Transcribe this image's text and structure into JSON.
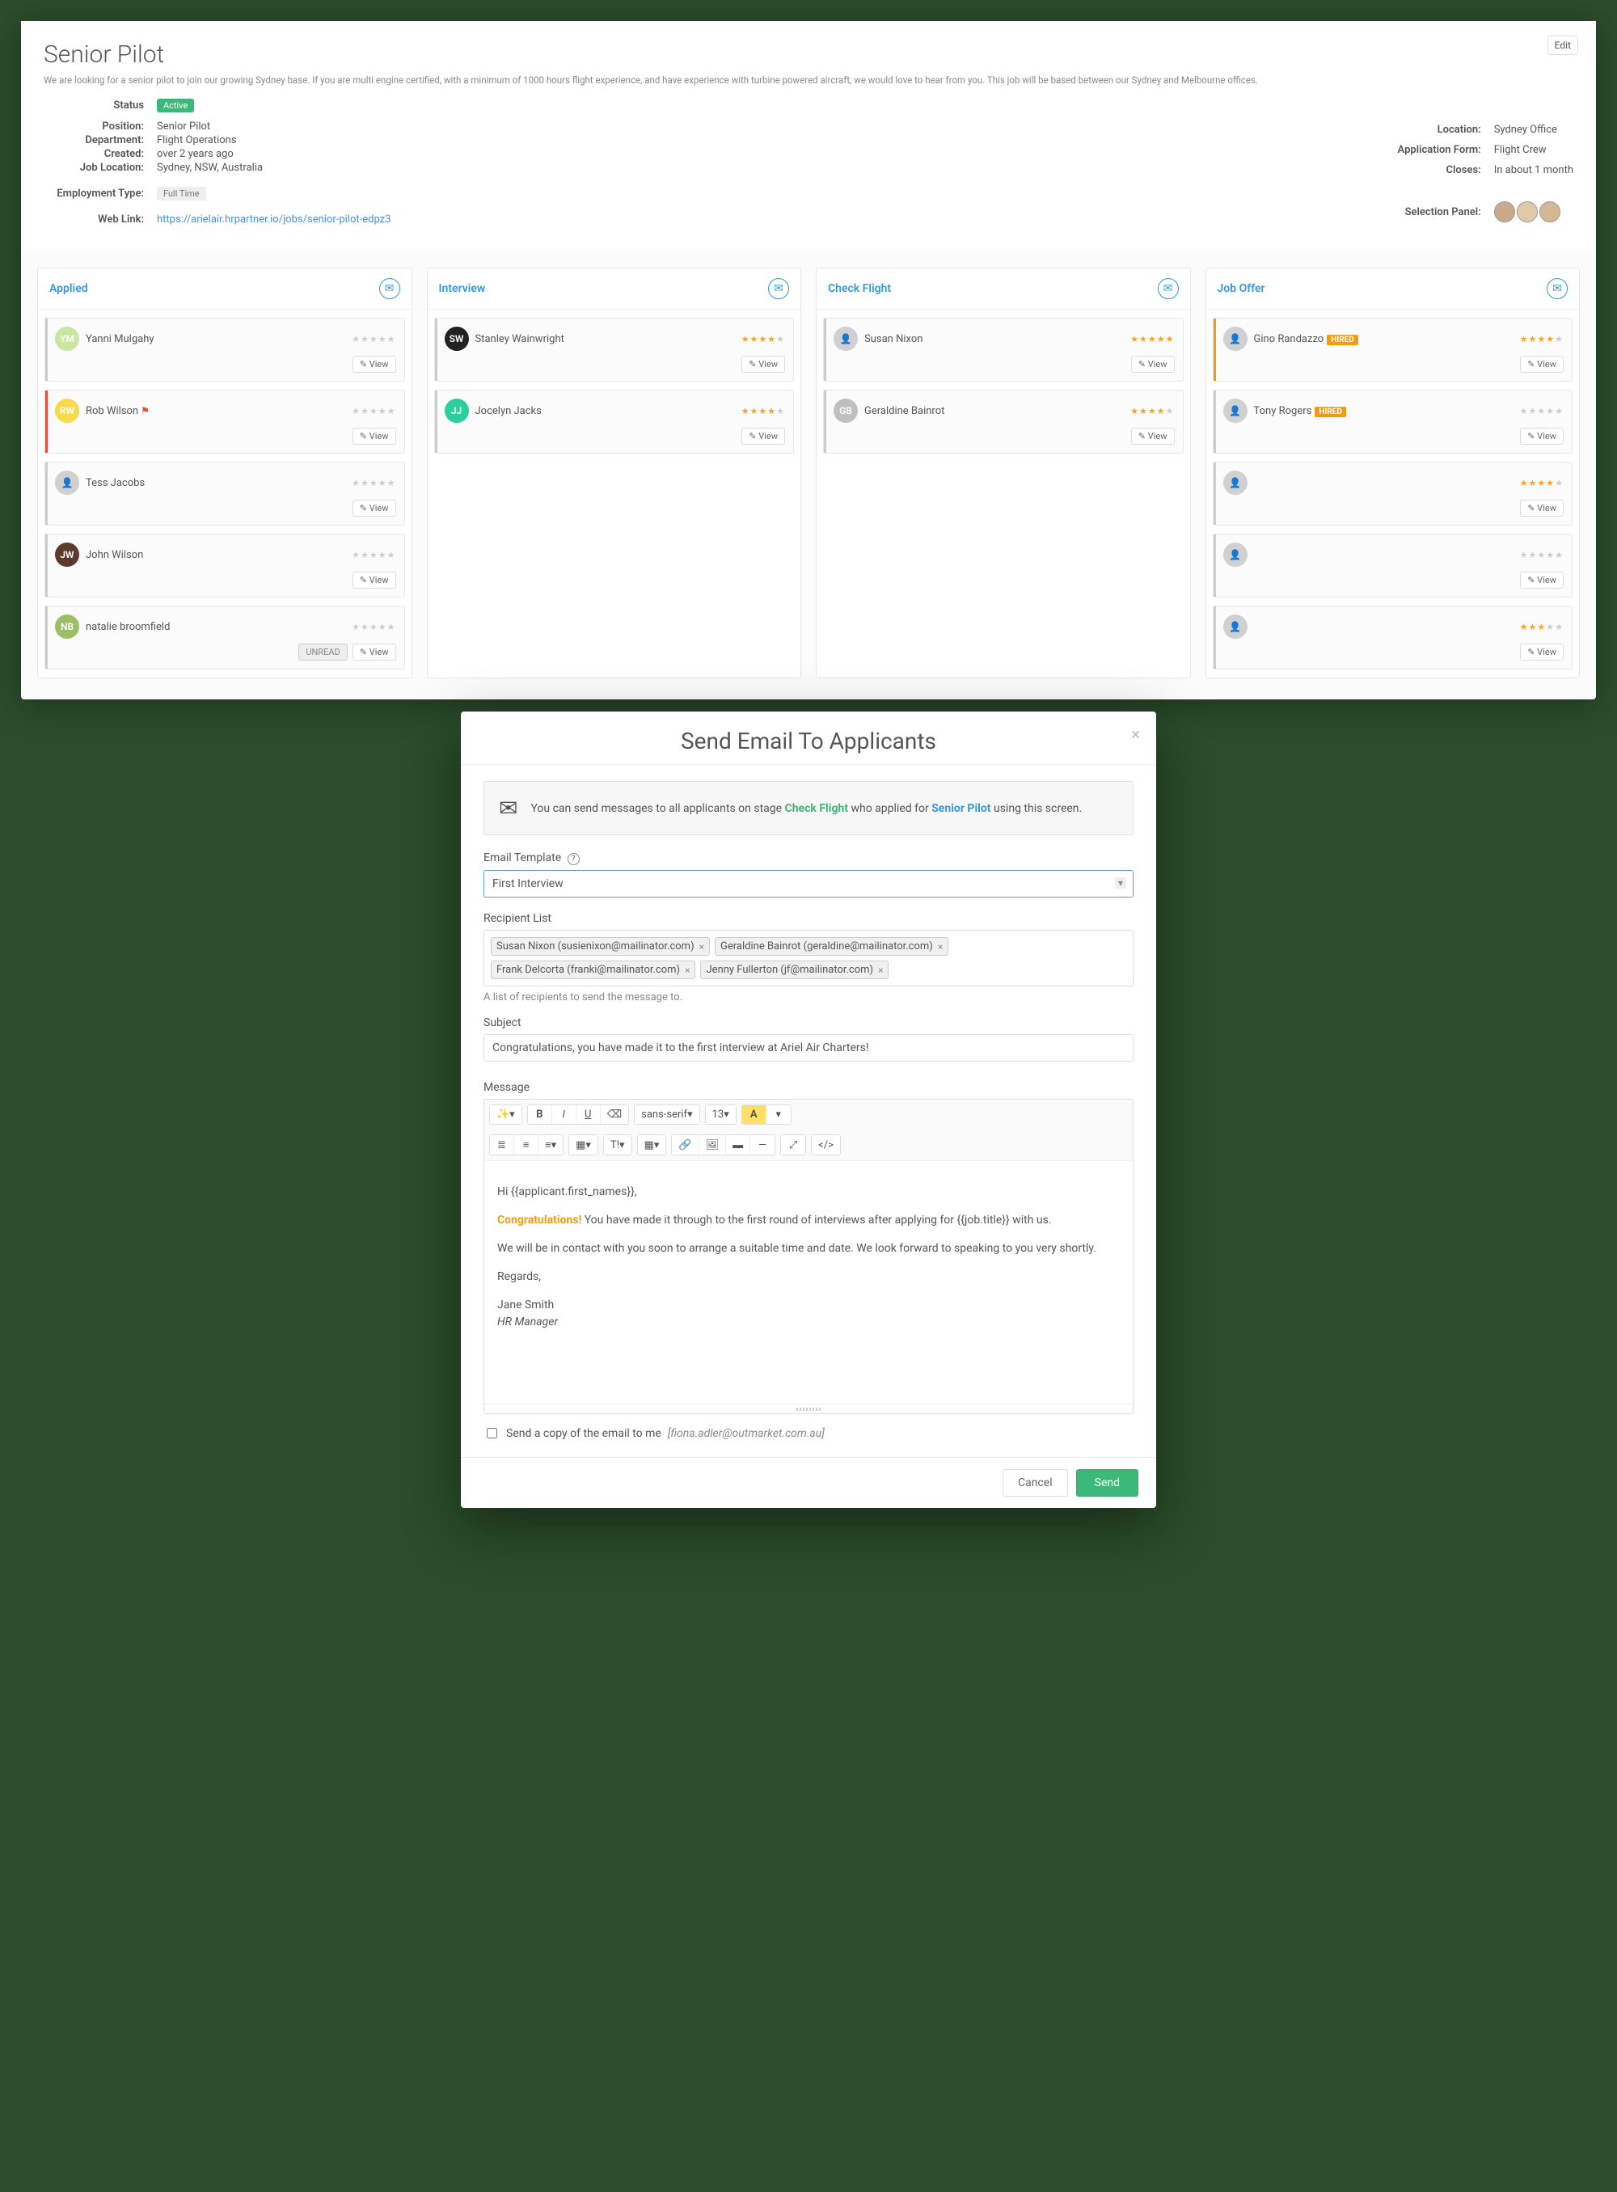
{
  "job": {
    "title": "Senior Pilot",
    "editLabel": "Edit",
    "description": "We are looking for a senior pilot to join our growing Sydney base. If you are multi engine certified, with a minimum of 1000 hours flight experience, and have experience with turbine powered aircraft, we would love to hear from you. This job will be based between our Sydney and Melbourne offices.",
    "statusLabel": "Status",
    "statusValue": "Active",
    "left": {
      "positionK": "Position:",
      "positionV": "Senior Pilot",
      "deptK": "Department:",
      "deptV": "Flight Operations",
      "createdK": "Created:",
      "createdV": "over 2 years ago",
      "jobLocK": "Job Location:",
      "jobLocV": "Sydney, NSW, Australia",
      "empTypeK": "Employment Type:",
      "empTypeV": "Full Time",
      "webLinkK": "Web Link:",
      "webLinkV": "https://arielair.hrpartner.io/jobs/senior-pilot-edpz3"
    },
    "right": {
      "locationK": "Location:",
      "locationV": "Sydney Office",
      "appFormK": "Application Form:",
      "appFormV": "Flight Crew",
      "closesK": "Closes:",
      "closesV": "In about 1 month",
      "panelK": "Selection Panel:"
    }
  },
  "stages": {
    "applied": {
      "title": "Applied"
    },
    "interview": {
      "title": "Interview"
    },
    "checkflight": {
      "title": "Check Flight"
    },
    "joboffer": {
      "title": "Job Offer"
    }
  },
  "cards": {
    "viewLabel": "View",
    "unreadLabel": "UNREAD",
    "hiredLabel": "HIRED",
    "applied": [
      {
        "initials": "YM",
        "name": "Yanni Mulgahy",
        "color": "#c8e6a0",
        "stars": 0,
        "flag": false,
        "bar": ""
      },
      {
        "initials": "RW",
        "name": "Rob Wilson",
        "color": "#f7d94c",
        "stars": 0,
        "flag": true,
        "bar": "bar-red"
      },
      {
        "initials": "",
        "name": "Tess Jacobs",
        "color": "#d0d0d0",
        "stars": 0,
        "flag": false,
        "bar": ""
      },
      {
        "initials": "JW",
        "name": "John Wilson",
        "color": "#5c3b2e",
        "stars": 0,
        "flag": false,
        "bar": ""
      },
      {
        "initials": "NB",
        "name": "natalie broomfield",
        "color": "#9bbf65",
        "stars": 0,
        "flag": false,
        "bar": "",
        "unread": true
      }
    ],
    "interview": [
      {
        "initials": "SW",
        "name": "Stanley Wainwright",
        "color": "#222",
        "stars": 4,
        "bar": ""
      },
      {
        "initials": "JJ",
        "name": "Jocelyn Jacks",
        "color": "#2bcf9b",
        "stars": 4,
        "bar": ""
      }
    ],
    "checkflight": [
      {
        "initials": "",
        "name": "Susan Nixon",
        "color": "#d0d0d0",
        "stars": 5,
        "bar": ""
      },
      {
        "initials": "GB",
        "name": "Geraldine Bainrot",
        "color": "#bfbfbf",
        "stars": 4,
        "bar": ""
      }
    ],
    "joboffer": [
      {
        "initials": "",
        "name": "Gino Randazzo",
        "color": "#d0d0d0",
        "stars": 4,
        "bar": "bar-orange",
        "hired": true
      },
      {
        "initials": "",
        "name": "Tony Rogers",
        "color": "#d0d0d0",
        "stars": 0,
        "bar": "",
        "hired": true
      },
      {
        "initials": "",
        "name": "",
        "color": "#d0d0d0",
        "stars": 4,
        "bar": ""
      },
      {
        "initials": "",
        "name": "",
        "color": "#d0d0d0",
        "stars": 0,
        "bar": ""
      },
      {
        "initials": "",
        "name": "",
        "color": "#d0d0d0",
        "stars": 3,
        "bar": ""
      }
    ]
  },
  "modal": {
    "title": "Send Email To Applicants",
    "noticePre": "You can send messages to all applicants on stage ",
    "noticeStage": "Check Flight",
    "noticeMid": " who applied for ",
    "noticeJob": "Senior Pilot",
    "noticePost": " using this screen.",
    "templateLabel": "Email Template",
    "templateValue": "First Interview",
    "recipLabel": "Recipient List",
    "recipients": [
      "Susan Nixon (susienixon@mailinator.com)",
      "Geraldine Bainrot (geraldine@mailinator.com)",
      "Frank Delcorta (franki@mailinator.com)",
      "Jenny Fullerton (jf@mailinator.com)"
    ],
    "recipHint": "A list of recipients to send the message to.",
    "subjectLabel": "Subject",
    "subjectValue": "Congratulations, you have made it to the first interview at Ariel Air Charters!",
    "messageLabel": "Message",
    "body": {
      "line1": "Hi {{applicant.first_names}},",
      "congrats": "Congratulations!",
      "line2": " You have made it through to the first round of interviews after applying for {{job.title}} with us.",
      "line3": "We will be in contact with you soon to arrange a suitable time and date.  We look forward to speaking to you very shortly.",
      "line4": "Regards,",
      "line5a": "Jane Smith",
      "line5b": "HR Manager"
    },
    "copyLabel": "Send a copy of the email to me ",
    "copyEmail": "[fiona.adler@outmarket.com.au]",
    "cancel": "Cancel",
    "send": "Send",
    "toolbar": {
      "font": "sans-serif",
      "size": "13"
    }
  }
}
